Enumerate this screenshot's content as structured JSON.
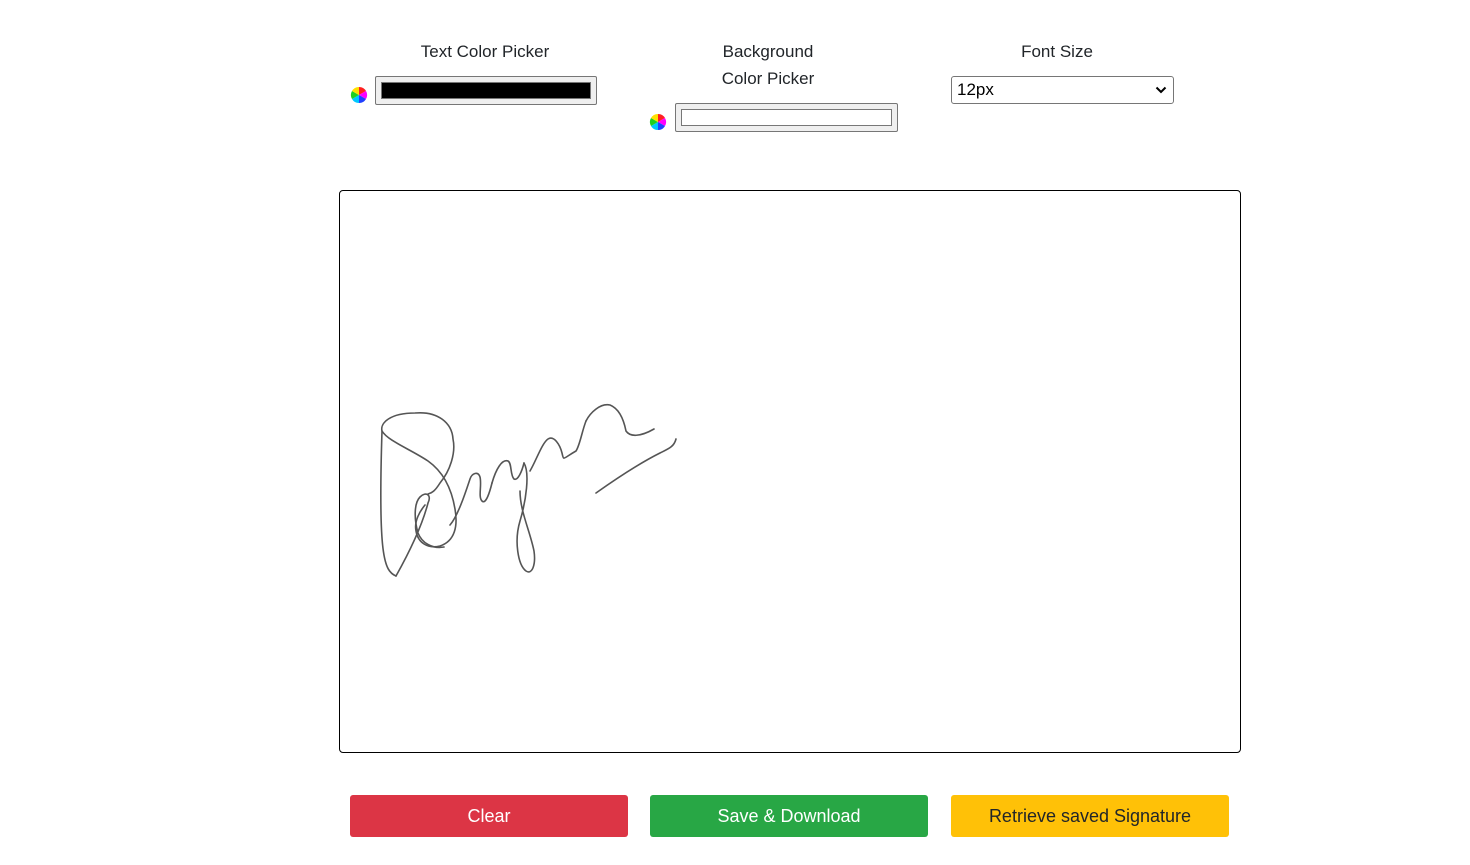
{
  "controls": {
    "text_color": {
      "label": "Text Color Picker",
      "value": "#000000",
      "icon": "color-wheel-icon"
    },
    "background_color": {
      "label_line1": "Background",
      "label_line2": "Color Picker",
      "value": "#ffffff",
      "icon": "color-wheel-icon"
    },
    "font_size": {
      "label": "Font Size",
      "selected": "12px"
    }
  },
  "signature": {
    "stroke_color": "#555555"
  },
  "buttons": {
    "clear": {
      "label": "Clear",
      "color": "#dc3545",
      "text_color": "#ffffff"
    },
    "save": {
      "label": "Save & Download",
      "color": "#28a745",
      "text_color": "#ffffff"
    },
    "retrieve": {
      "label": "Retrieve saved Signature",
      "color": "#ffc107",
      "text_color": "#212529"
    }
  }
}
